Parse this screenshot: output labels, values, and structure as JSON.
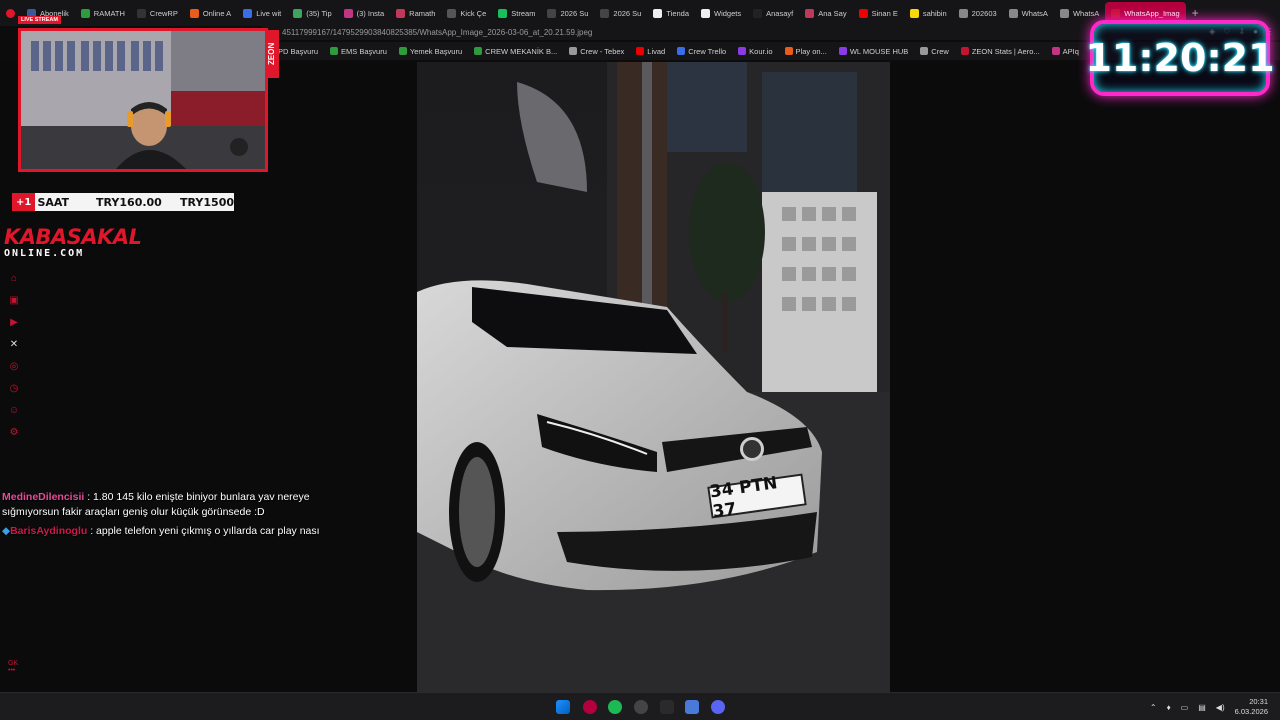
{
  "browser": {
    "tabs": [
      {
        "label": "Abonelik",
        "color": "#3b5998"
      },
      {
        "label": "RAMATH",
        "color": "#2e9c3c"
      },
      {
        "label": "CrewRP",
        "color": "#333"
      },
      {
        "label": "Online A",
        "color": "#e85d1c"
      },
      {
        "label": "Live wit",
        "color": "#3a6ee8"
      },
      {
        "label": "(35) Tip",
        "color": "#3da35d"
      },
      {
        "label": "(3) Insta",
        "color": "#c13584"
      },
      {
        "label": "Ramath",
        "color": "#c0395b"
      },
      {
        "label": "Kick Çe",
        "color": "#555"
      },
      {
        "label": "Stream",
        "color": "#17c05b"
      },
      {
        "label": "2026 Su",
        "color": "#444"
      },
      {
        "label": "2026 Su",
        "color": "#444"
      },
      {
        "label": "Tienda",
        "color": "#eee"
      },
      {
        "label": "Widgets",
        "color": "#eee"
      },
      {
        "label": "Anasayf",
        "color": "#222"
      },
      {
        "label": "Ana Say",
        "color": "#c0395b"
      },
      {
        "label": "Sinan E",
        "color": "#e00"
      },
      {
        "label": "sahibin",
        "color": "#f5d90a"
      },
      {
        "label": "202603",
        "color": "#888"
      },
      {
        "label": "WhatsA",
        "color": "#888"
      },
      {
        "label": "WhatsA",
        "color": "#888"
      },
      {
        "label": "WhatsApp_Imag",
        "color": "#c41432",
        "active": true
      }
    ],
    "url": "45117999167/1479529903840825385/WhatsApp_Image_2026-03-06_at_20.21.59.jpeg",
    "bookmarks": [
      {
        "label": "PD Başvuru",
        "color": "#2e9c3c"
      },
      {
        "label": "EMS Başvuru",
        "color": "#2e9c3c"
      },
      {
        "label": "Yemek Başvuru",
        "color": "#2e9c3c"
      },
      {
        "label": "CREW MEKANİK B...",
        "color": "#2e9c3c"
      },
      {
        "label": "Crew - Tebex",
        "color": "#999"
      },
      {
        "label": "Livad",
        "color": "#e00"
      },
      {
        "label": "Crew Trello",
        "color": "#3a6ee8"
      },
      {
        "label": "Kour.io",
        "color": "#8b3ae8"
      },
      {
        "label": "Play on...",
        "color": "#e85d1c"
      },
      {
        "label": "WL MOUSE HUB",
        "color": "#8b3ae8"
      },
      {
        "label": "Crew",
        "color": "#999"
      },
      {
        "label": "ZEON Stats | Aero...",
        "color": "#c41432"
      },
      {
        "label": "APIq",
        "color": "#c13584"
      }
    ]
  },
  "overlay": {
    "live_tag": "LIVE STREAM",
    "zeon": "ZEON",
    "sub_goal": {
      "badge": "+1",
      "label": "SAAT",
      "value1": "TRY160.00",
      "value2": "TRY1500"
    },
    "logo_line1": "KABASAKAL",
    "logo_line2": "ONLINE.COM",
    "clock": "11:20:21",
    "side_icons": [
      "kick-icon",
      "twitch-icon",
      "youtube-icon",
      "x-icon",
      "instagram-icon",
      "clock-icon",
      "discord-icon",
      "settings-icon"
    ],
    "gk_label": "GK"
  },
  "chat": [
    {
      "user": "MedineDilencisii",
      "text": " : 1.80 145 kilo enişte biniyor bunlara yav nereye sığmıyorsun fakir araçları geniş olur küçük görünsede :D"
    },
    {
      "user": "BarisAydinoglu",
      "text": " : apple telefon yeni çıkmış o yıllarda car play nası"
    }
  ],
  "photo": {
    "plate": "34 PTN 37"
  },
  "taskbar": {
    "time": "20:31",
    "date": "6.03.2026"
  }
}
